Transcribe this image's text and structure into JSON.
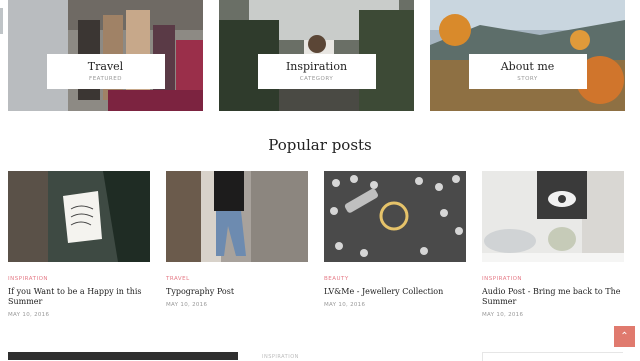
{
  "categories": [
    {
      "title": "Travel",
      "subtitle": "FEATURED"
    },
    {
      "title": "Inspiration",
      "subtitle": "CATEGORY"
    },
    {
      "title": "About me",
      "subtitle": "STORY"
    }
  ],
  "popular": {
    "heading": "Popular posts",
    "posts": [
      {
        "category": "INSPIRATION",
        "title": "If you Want to be a Happy in this Summer",
        "date": "MAY 10, 2016"
      },
      {
        "category": "TRAVEL",
        "title": "Typography Post",
        "date": "MAY 10, 2016"
      },
      {
        "category": "BEAUTY",
        "title": "LV&Me - Jewellery Collection",
        "date": "MAY 10, 2016"
      },
      {
        "category": "INSPIRATION",
        "title": "Audio Post - Bring me back to The Summer",
        "date": "MAY 10, 2016"
      }
    ]
  },
  "bottom": {
    "category": "INSPIRATION"
  },
  "scroll_top_icon": "arrow-up-icon",
  "colors": {
    "accent": "#e57a86",
    "scroll_top": "#e07a6e"
  }
}
